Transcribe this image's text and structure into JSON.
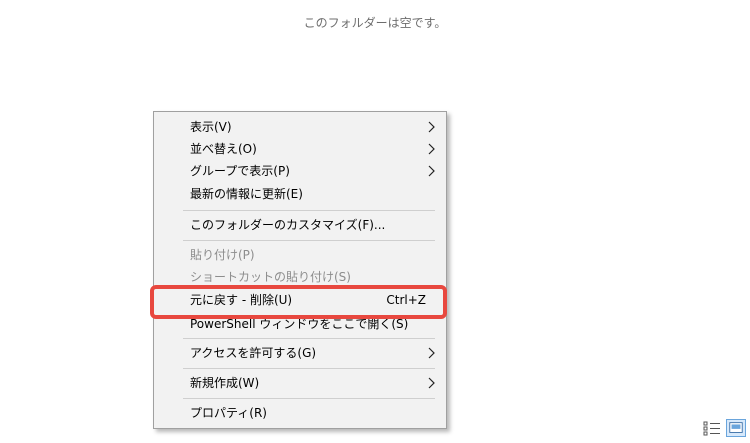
{
  "folder": {
    "empty_message": "このフォルダーは空です。"
  },
  "context_menu": {
    "items": [
      {
        "label": "表示(V)",
        "submenu": true,
        "disabled": false
      },
      {
        "label": "並べ替え(O)",
        "submenu": true,
        "disabled": false
      },
      {
        "label": "グループで表示(P)",
        "submenu": true,
        "disabled": false
      },
      {
        "label": "最新の情報に更新(E)",
        "submenu": false,
        "disabled": false
      },
      {
        "label": "このフォルダーのカスタマイズ(F)...",
        "submenu": false,
        "disabled": false
      },
      {
        "label": "貼り付け(P)",
        "submenu": false,
        "disabled": true
      },
      {
        "label": "ショートカットの貼り付け(S)",
        "submenu": false,
        "disabled": true
      },
      {
        "label": "元に戻す - 削除(U)",
        "shortcut": "Ctrl+Z",
        "submenu": false,
        "disabled": false,
        "highlighted": true
      },
      {
        "label": "PowerShell ウィンドウをここで開く(S)",
        "submenu": false,
        "disabled": false
      },
      {
        "label": "アクセスを許可する(G)",
        "submenu": true,
        "disabled": false
      },
      {
        "label": "新規作成(W)",
        "submenu": true,
        "disabled": false
      },
      {
        "label": "プロパティ(R)",
        "submenu": false,
        "disabled": false
      }
    ]
  },
  "view_controls": {
    "details_icon": "details-view-icon",
    "tiles_icon": "large-icons-view-icon"
  },
  "colors": {
    "highlight_outline": "#e8483f",
    "menu_background": "#f2f2f2",
    "disabled_text": "#8d8d8d",
    "active_view_background": "#d7e9fb"
  }
}
